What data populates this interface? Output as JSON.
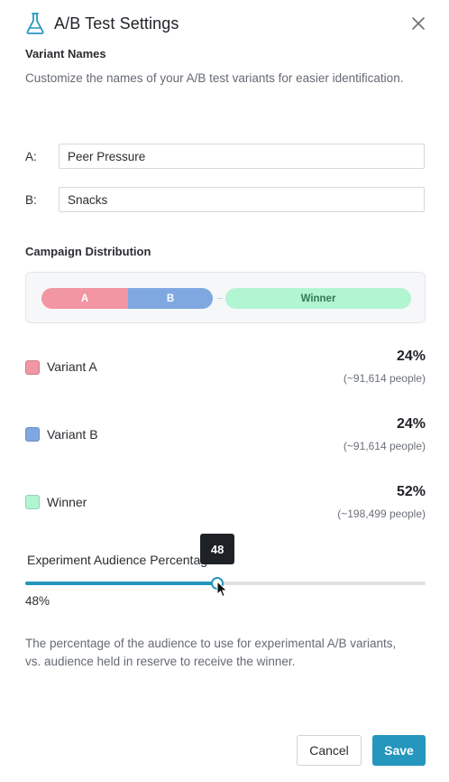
{
  "dialog": {
    "title": "A/B Test Settings",
    "icon": "flask-icon",
    "close_icon": "close-icon"
  },
  "variant_names": {
    "heading": "Variant Names",
    "description": "Customize the names of your A/B test variants for easier identification.",
    "a_label": "A:",
    "a_value": "Peer Pressure",
    "b_label": "B:",
    "b_value": "Snacks"
  },
  "distribution": {
    "heading": "Campaign Distribution",
    "bar": {
      "a_label": "A",
      "b_label": "B",
      "winner_label": "Winner"
    },
    "variants": [
      {
        "name": "Variant A",
        "percent": "24%",
        "people": "(~91,614 people)",
        "color": "#f296a3"
      },
      {
        "name": "Variant B",
        "percent": "24%",
        "people": "(~91,614 people)",
        "color": "#7fa8e1"
      },
      {
        "name": "Winner",
        "percent": "52%",
        "people": "(~198,499 people)",
        "color": "#b2f5d3"
      }
    ]
  },
  "slider": {
    "label": "Experiment Audience Percentage",
    "tooltip": "48",
    "value_text": "48%",
    "value": 48,
    "min": 0,
    "max": 100,
    "description": "The percentage of the audience to use for experimental A/B variants, vs. audience held in reserve to receive the winner."
  },
  "footer": {
    "cancel_label": "Cancel",
    "save_label": "Save"
  },
  "colors": {
    "accent": "#2596be",
    "variant_a": "#f296a3",
    "variant_b": "#7fa8e1",
    "winner": "#b2f5d3"
  }
}
